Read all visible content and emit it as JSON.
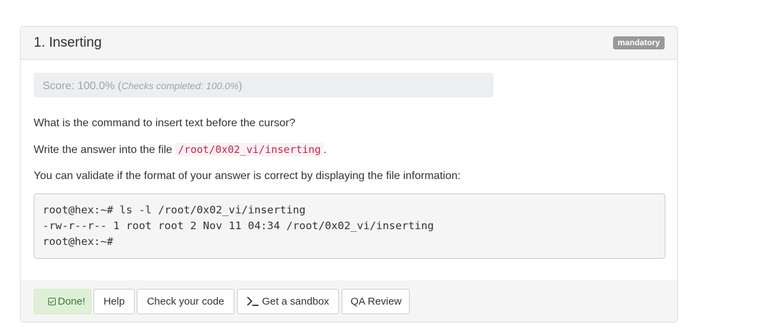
{
  "task": {
    "title": "1. Inserting",
    "badge": "mandatory"
  },
  "score": {
    "label": "Score: 100.0% (",
    "detail": "Checks completed: 100.0%",
    "close": ")"
  },
  "description": {
    "question": "What is the command to insert text before the cursor?",
    "answer_prefix": "Write the answer into the file ",
    "answer_file": "/root/0x02_vi/inserting",
    "answer_suffix": ".",
    "validate_text": "You can validate if the format of your answer is correct by displaying the file information:"
  },
  "terminal": {
    "lines": [
      "root@hex:~# ls -l /root/0x02_vi/inserting",
      "-rw-r--r-- 1 root root 2 Nov 11 04:34 /root/0x02_vi/inserting",
      "root@hex:~#"
    ]
  },
  "footer": {
    "done_label": "Done!",
    "help_label": "Help",
    "check_code_label": "Check your code",
    "sandbox_label": "Get a sandbox",
    "qa_review_label": "QA Review"
  },
  "icons": {
    "done": "checkbox-checked-icon",
    "sandbox": "terminal-prompt-icon"
  },
  "colors": {
    "done_bg": "#dff0d8",
    "done_text": "#3c763d",
    "badge_bg": "#999999",
    "inline_code": "#c7254e"
  }
}
